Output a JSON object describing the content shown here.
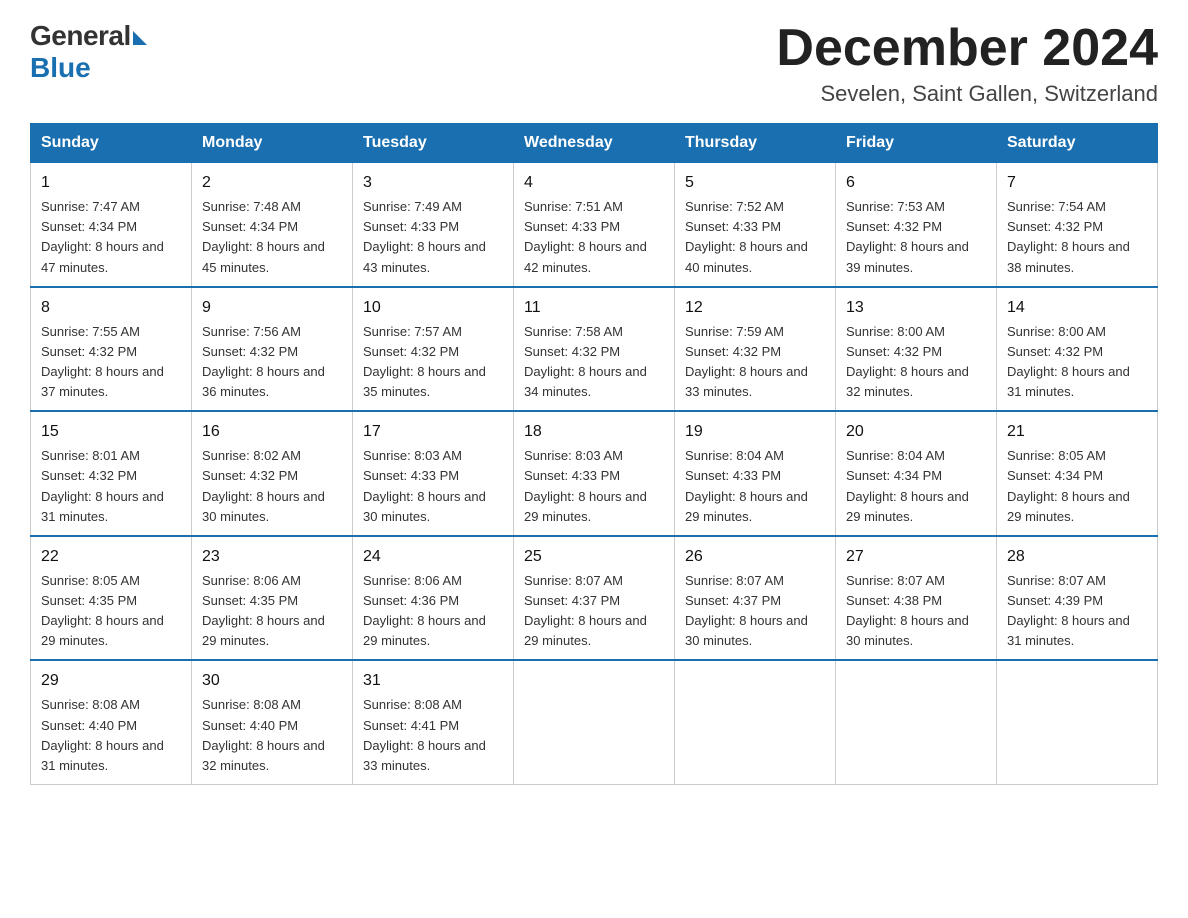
{
  "header": {
    "logo_general": "General",
    "logo_blue": "Blue",
    "month_title": "December 2024",
    "location": "Sevelen, Saint Gallen, Switzerland"
  },
  "days_of_week": [
    "Sunday",
    "Monday",
    "Tuesday",
    "Wednesday",
    "Thursday",
    "Friday",
    "Saturday"
  ],
  "weeks": [
    [
      {
        "day": "1",
        "sunrise": "7:47 AM",
        "sunset": "4:34 PM",
        "daylight": "8 hours and 47 minutes."
      },
      {
        "day": "2",
        "sunrise": "7:48 AM",
        "sunset": "4:34 PM",
        "daylight": "8 hours and 45 minutes."
      },
      {
        "day": "3",
        "sunrise": "7:49 AM",
        "sunset": "4:33 PM",
        "daylight": "8 hours and 43 minutes."
      },
      {
        "day": "4",
        "sunrise": "7:51 AM",
        "sunset": "4:33 PM",
        "daylight": "8 hours and 42 minutes."
      },
      {
        "day": "5",
        "sunrise": "7:52 AM",
        "sunset": "4:33 PM",
        "daylight": "8 hours and 40 minutes."
      },
      {
        "day": "6",
        "sunrise": "7:53 AM",
        "sunset": "4:32 PM",
        "daylight": "8 hours and 39 minutes."
      },
      {
        "day": "7",
        "sunrise": "7:54 AM",
        "sunset": "4:32 PM",
        "daylight": "8 hours and 38 minutes."
      }
    ],
    [
      {
        "day": "8",
        "sunrise": "7:55 AM",
        "sunset": "4:32 PM",
        "daylight": "8 hours and 37 minutes."
      },
      {
        "day": "9",
        "sunrise": "7:56 AM",
        "sunset": "4:32 PM",
        "daylight": "8 hours and 36 minutes."
      },
      {
        "day": "10",
        "sunrise": "7:57 AM",
        "sunset": "4:32 PM",
        "daylight": "8 hours and 35 minutes."
      },
      {
        "day": "11",
        "sunrise": "7:58 AM",
        "sunset": "4:32 PM",
        "daylight": "8 hours and 34 minutes."
      },
      {
        "day": "12",
        "sunrise": "7:59 AM",
        "sunset": "4:32 PM",
        "daylight": "8 hours and 33 minutes."
      },
      {
        "day": "13",
        "sunrise": "8:00 AM",
        "sunset": "4:32 PM",
        "daylight": "8 hours and 32 minutes."
      },
      {
        "day": "14",
        "sunrise": "8:00 AM",
        "sunset": "4:32 PM",
        "daylight": "8 hours and 31 minutes."
      }
    ],
    [
      {
        "day": "15",
        "sunrise": "8:01 AM",
        "sunset": "4:32 PM",
        "daylight": "8 hours and 31 minutes."
      },
      {
        "day": "16",
        "sunrise": "8:02 AM",
        "sunset": "4:32 PM",
        "daylight": "8 hours and 30 minutes."
      },
      {
        "day": "17",
        "sunrise": "8:03 AM",
        "sunset": "4:33 PM",
        "daylight": "8 hours and 30 minutes."
      },
      {
        "day": "18",
        "sunrise": "8:03 AM",
        "sunset": "4:33 PM",
        "daylight": "8 hours and 29 minutes."
      },
      {
        "day": "19",
        "sunrise": "8:04 AM",
        "sunset": "4:33 PM",
        "daylight": "8 hours and 29 minutes."
      },
      {
        "day": "20",
        "sunrise": "8:04 AM",
        "sunset": "4:34 PM",
        "daylight": "8 hours and 29 minutes."
      },
      {
        "day": "21",
        "sunrise": "8:05 AM",
        "sunset": "4:34 PM",
        "daylight": "8 hours and 29 minutes."
      }
    ],
    [
      {
        "day": "22",
        "sunrise": "8:05 AM",
        "sunset": "4:35 PM",
        "daylight": "8 hours and 29 minutes."
      },
      {
        "day": "23",
        "sunrise": "8:06 AM",
        "sunset": "4:35 PM",
        "daylight": "8 hours and 29 minutes."
      },
      {
        "day": "24",
        "sunrise": "8:06 AM",
        "sunset": "4:36 PM",
        "daylight": "8 hours and 29 minutes."
      },
      {
        "day": "25",
        "sunrise": "8:07 AM",
        "sunset": "4:37 PM",
        "daylight": "8 hours and 29 minutes."
      },
      {
        "day": "26",
        "sunrise": "8:07 AM",
        "sunset": "4:37 PM",
        "daylight": "8 hours and 30 minutes."
      },
      {
        "day": "27",
        "sunrise": "8:07 AM",
        "sunset": "4:38 PM",
        "daylight": "8 hours and 30 minutes."
      },
      {
        "day": "28",
        "sunrise": "8:07 AM",
        "sunset": "4:39 PM",
        "daylight": "8 hours and 31 minutes."
      }
    ],
    [
      {
        "day": "29",
        "sunrise": "8:08 AM",
        "sunset": "4:40 PM",
        "daylight": "8 hours and 31 minutes."
      },
      {
        "day": "30",
        "sunrise": "8:08 AM",
        "sunset": "4:40 PM",
        "daylight": "8 hours and 32 minutes."
      },
      {
        "day": "31",
        "sunrise": "8:08 AM",
        "sunset": "4:41 PM",
        "daylight": "8 hours and 33 minutes."
      },
      null,
      null,
      null,
      null
    ]
  ]
}
